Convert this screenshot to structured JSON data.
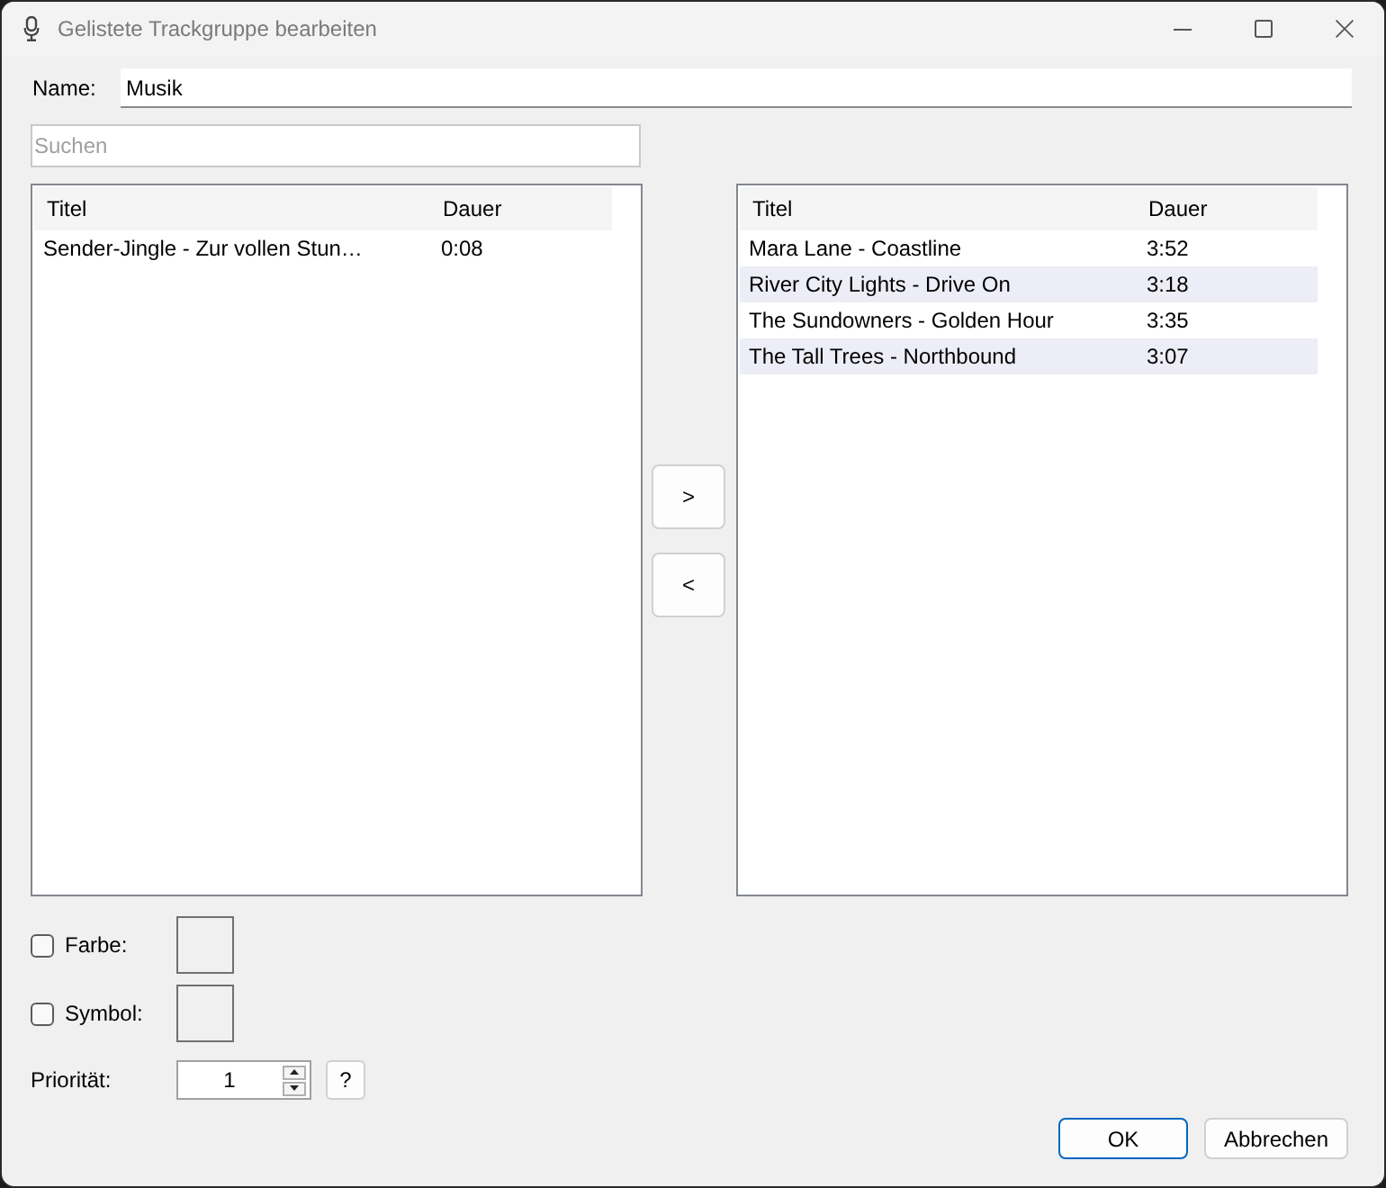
{
  "window": {
    "title": "Gelistete Trackgruppe bearbeiten"
  },
  "name": {
    "label": "Name:",
    "value": "Musik"
  },
  "search": {
    "placeholder": "Suchen"
  },
  "available_tracks": {
    "columns": [
      "Titel",
      "Dauer"
    ],
    "rows": [
      [
        "Sender-Jingle - Zur vollen Stun…",
        "0:08"
      ]
    ]
  },
  "move_buttons": [
    ">",
    "<"
  ],
  "group_tracks": {
    "columns": [
      "Titel",
      "Dauer"
    ],
    "rows": [
      [
        "Mara Lane - Coastline",
        "3:52"
      ],
      [
        "River City Lights - Drive On",
        "3:18"
      ],
      [
        "The Sundowners - Golden Hour",
        "3:35"
      ],
      [
        "The Tall Trees - Northbound",
        "3:07"
      ]
    ]
  },
  "options": [
    {
      "label": "Farbe:",
      "checked": false
    },
    {
      "label": "Symbol:",
      "checked": false
    }
  ],
  "priority": {
    "label": "Priorität:",
    "value": "1",
    "help": "?"
  },
  "buttons": [
    {
      "label": "OK",
      "default": true
    },
    {
      "label": "Abbrechen",
      "default": false
    }
  ]
}
